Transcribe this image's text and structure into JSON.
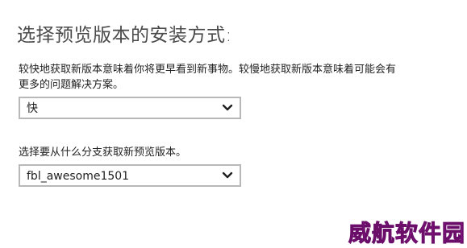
{
  "page": {
    "title": "选择预览版本的安装方式:",
    "description": "较快地获取新版本意味着你将更早看到新事物。较慢地获取新版本意味着可能会有更多的问题解决方案。"
  },
  "speed_select": {
    "value": "快",
    "icon": "chevron-down-icon"
  },
  "branch_section": {
    "label": "选择要从什么分支获取新预览版本。"
  },
  "branch_select": {
    "value": "fbl_awesome1501",
    "icon": "chevron-down-icon"
  },
  "watermark": {
    "text": "威航软件园",
    "color": "#e23ad8"
  }
}
